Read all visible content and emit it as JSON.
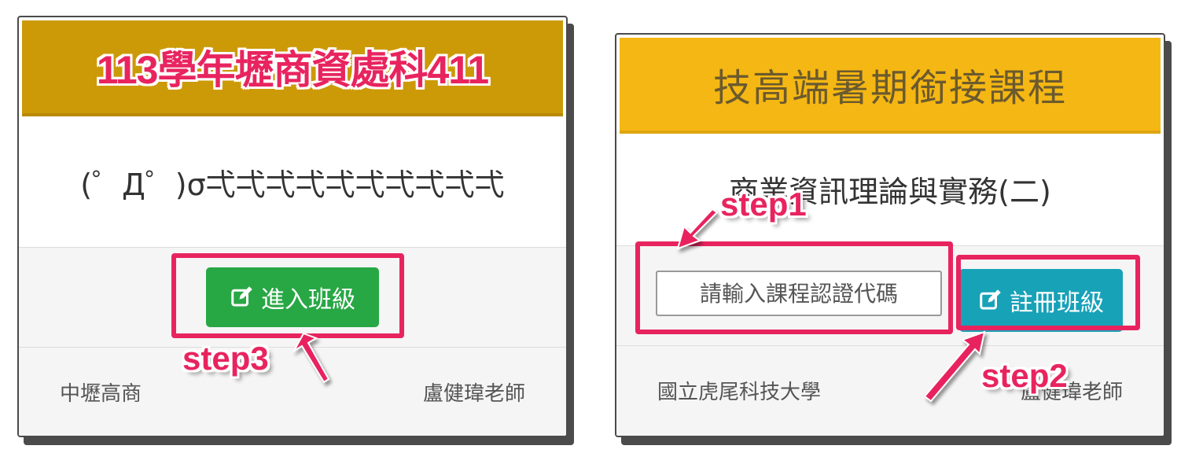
{
  "colors": {
    "highlight": "#e8245f",
    "left_header": "#cc9a06",
    "right_header": "#f5b713",
    "enter_button": "#28a745",
    "register_button": "#17a2b8"
  },
  "left_card": {
    "title": "113學年壢商資處科411",
    "course_name": "(゜Д゜)σ弌弌弌弌弌弌弌弌弌弌",
    "enter_button_label": "進入班級",
    "enter_button_icon": "edit-icon",
    "school": "中壢高商",
    "teacher": "盧健瑋老師"
  },
  "right_card": {
    "title": "技高端暑期銜接課程",
    "course_name": "商業資訊理論與實務(二)",
    "code_input_placeholder": "請輸入課程認證代碼",
    "register_button_label": "註冊班級",
    "register_button_icon": "edit-icon",
    "school": "國立虎尾科技大學",
    "teacher": "盧健瑋老師"
  },
  "annotations": {
    "step1": "step1",
    "step2": "step2",
    "step3": "step3"
  }
}
